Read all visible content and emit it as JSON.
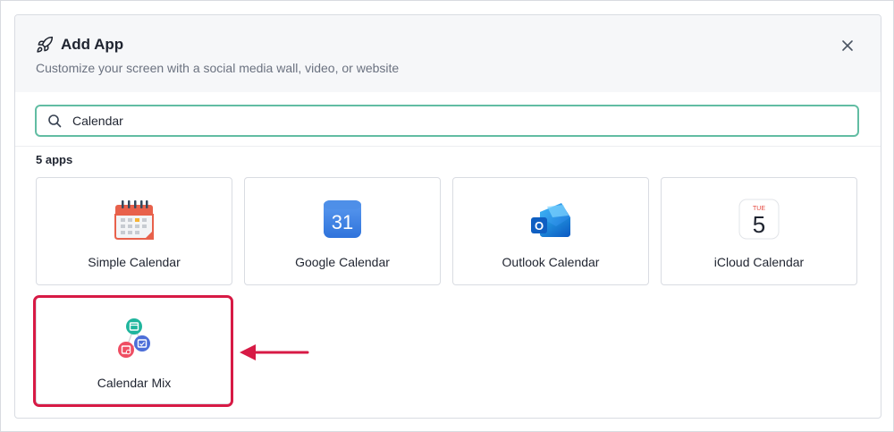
{
  "dialog": {
    "title": "Add App",
    "subtitle": "Customize your screen with a social media wall, video, or website",
    "close_icon": "close-icon",
    "title_icon": "rocket-icon"
  },
  "search": {
    "value": "Calendar",
    "icon": "search-icon"
  },
  "results": {
    "count_label": "5 apps",
    "apps": [
      {
        "label": "Simple Calendar",
        "icon": "simple-calendar-icon"
      },
      {
        "label": "Google Calendar",
        "icon": "google-calendar-icon",
        "icon_text": "31"
      },
      {
        "label": "Outlook Calendar",
        "icon": "outlook-calendar-icon",
        "icon_text": "O"
      },
      {
        "label": "iCloud Calendar",
        "icon": "icloud-calendar-icon",
        "icon_day": "TUE",
        "icon_date": "5"
      },
      {
        "label": "Calendar Mix",
        "icon": "calendar-mix-icon"
      }
    ]
  },
  "annotation": {
    "highlighted_app": "Calendar Mix",
    "highlight_color": "#d71a45"
  },
  "colors": {
    "accent": "#62bda3",
    "header_bg": "#f6f7f9"
  }
}
